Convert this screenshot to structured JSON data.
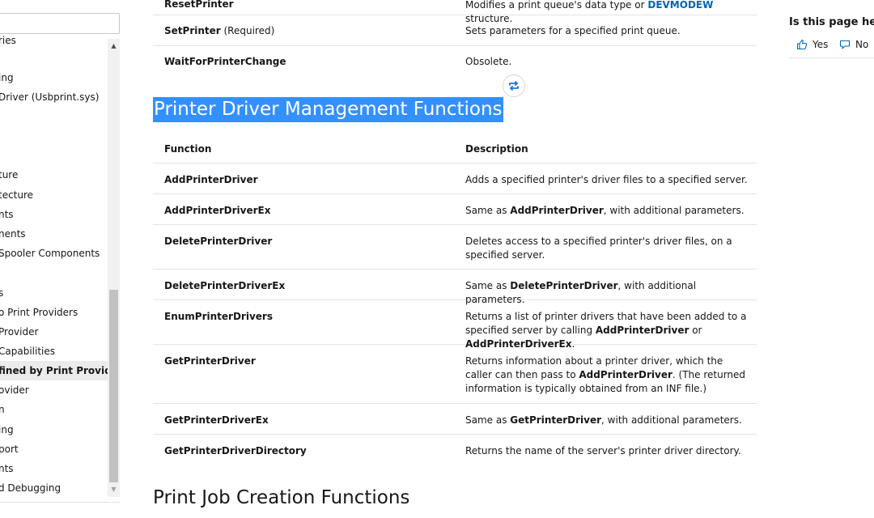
{
  "nav": {
    "items": [
      {
        "label": "ries"
      },
      {
        "label": "ing"
      },
      {
        "label": "Driver (Usbprint.sys)"
      },
      {
        "label": "ture"
      },
      {
        "label": "tecture"
      },
      {
        "label": "nts"
      },
      {
        "label": "nents"
      },
      {
        "label": "Spooler Components"
      },
      {
        "label": "s"
      },
      {
        "label": "o Print Providers"
      },
      {
        "label": "Provider"
      },
      {
        "label": "Capabilities"
      },
      {
        "label": "fined by Print Providers"
      },
      {
        "label": "ovider"
      },
      {
        "label": "n"
      },
      {
        "label": "ing"
      },
      {
        "label": "port"
      },
      {
        "label": "nts"
      },
      {
        "label": "d Debugging"
      }
    ]
  },
  "top_rows": [
    {
      "func": "ResetPrinter",
      "desc_pre": "Modifies a print queue's data type or ",
      "desc_link": "DEVMODEW",
      "desc_post": " structure."
    },
    {
      "func": "SetPrinter",
      "suffix": " (Required)",
      "desc": "Sets parameters for a specified print queue."
    },
    {
      "func": "WaitForPrinterChange",
      "desc": "Obsolete."
    }
  ],
  "section": {
    "heading": "Printer Driver Management Functions",
    "col_function": "Function",
    "col_description": "Description",
    "rows": [
      {
        "func": "AddPrinterDriver",
        "desc": "Adds a specified printer's driver files to a specified server."
      },
      {
        "func": "AddPrinterDriverEx",
        "d1": "Same as ",
        "b1": "AddPrinterDriver",
        "d2": ", with additional parameters."
      },
      {
        "func": "DeletePrinterDriver",
        "desc": "Deletes access to a specified printer's driver files, on a specified server."
      },
      {
        "func": "DeletePrinterDriverEx",
        "d1": "Same as ",
        "b1": "DeletePrinterDriver",
        "d2": ", with additional parameters."
      },
      {
        "func": "EnumPrinterDrivers",
        "d1": "Returns a list of printer drivers that have been added to a specified server by calling ",
        "b1": "AddPrinterDriver",
        "d2": " or ",
        "b2": "AddPrinterDriverEx",
        "d3": "."
      },
      {
        "func": "GetPrinterDriver",
        "d1": "Returns information about a printer driver, which the caller can then pass to ",
        "b1": "AddPrinterDriver",
        "d2": ". (The returned information is typically obtained from an INF file.)"
      },
      {
        "func": "GetPrinterDriverEx",
        "d1": "Same as ",
        "b1": "GetPrinterDriver",
        "d2": ", with additional parameters."
      },
      {
        "func": "GetPrinterDriverDirectory",
        "desc": "Returns the name of the server's printer driver directory."
      }
    ]
  },
  "next_heading": "Print Job Creation Functions",
  "feedback": {
    "title": "Is this page helpful?",
    "yes": "Yes",
    "no": "No"
  },
  "colors": {
    "accent": "#0065b3",
    "selection": "#3390ff"
  }
}
